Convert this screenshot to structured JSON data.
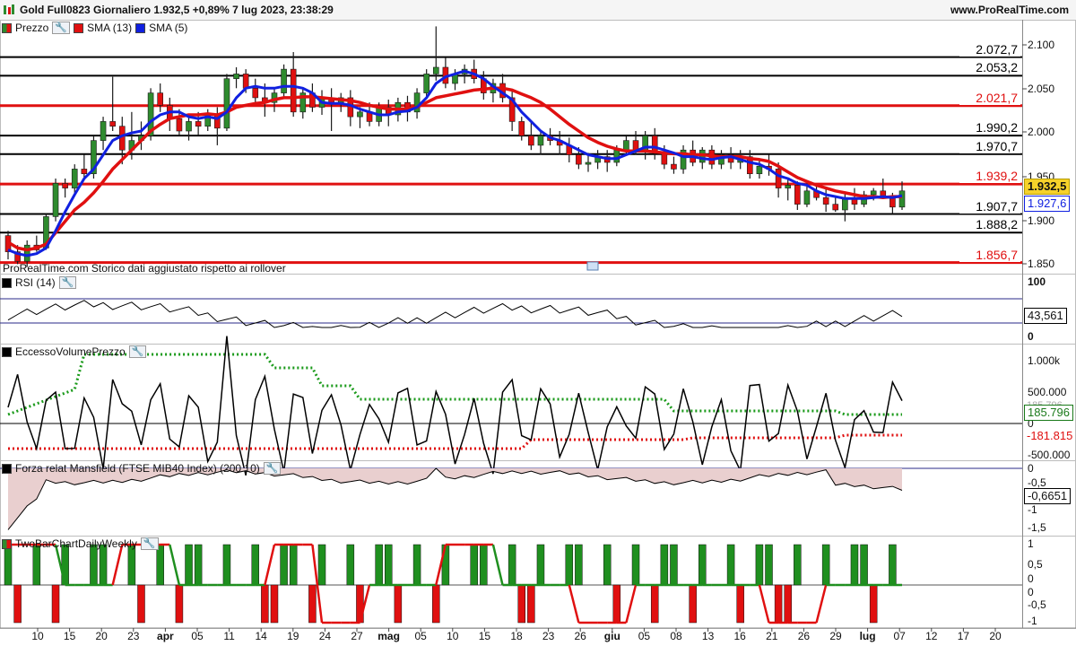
{
  "header": {
    "title": "Gold Full0823 Giornaliero 1.932,5 +0,89% 7 lug 2023, 23:38:29",
    "brand": "www.ProRealTime.com"
  },
  "price_panel": {
    "legend": [
      {
        "label": "Prezzo",
        "color": "#2e8b2e"
      },
      {
        "label": "SMA (13)",
        "color": "#e01010"
      },
      {
        "label": "SMA (5)",
        "color": "#1020e0"
      }
    ],
    "footnote": "ProRealTime.com  Storico dati aggiustato rispetto ai rollover",
    "y_ticks": [
      "2.100",
      "2.050",
      "2.000",
      "1.950",
      "1.900",
      "1.850"
    ],
    "levels": [
      {
        "label": "2.072,7",
        "value": 2072.7,
        "color": "#000000"
      },
      {
        "label": "2.053,2",
        "value": 2053.2,
        "color": "#000000"
      },
      {
        "label": "2.021,7",
        "value": 2021.7,
        "color": "#e01010"
      },
      {
        "label": "1.990,2",
        "value": 1990.2,
        "color": "#000000"
      },
      {
        "label": "1.970,7",
        "value": 1970.7,
        "color": "#000000"
      },
      {
        "label": "1.939,2",
        "value": 1939.2,
        "color": "#e01010"
      },
      {
        "label": "1.907,7",
        "value": 1907.7,
        "color": "#000000"
      },
      {
        "label": "1.888,2",
        "value": 1888.2,
        "color": "#000000"
      },
      {
        "label": "1.856,7",
        "value": 1856.7,
        "color": "#e01010"
      }
    ],
    "last_price": "1.932,5",
    "sma5_last": "1.927,6"
  },
  "rsi_panel": {
    "title": "RSI (14)",
    "ticks": [
      "100",
      "0"
    ],
    "value": "43,561"
  },
  "volume_panel": {
    "title": "EccessoVolumePrezzo",
    "ticks": [
      "1.000k",
      "500.000",
      "0",
      "-500.000"
    ],
    "upper_label": "185.796",
    "upper_hidden": "185.796",
    "lower_label": "-181.815"
  },
  "mansfield_panel": {
    "title": "Forza relat Mansfield (FTSE MIB40 Index) (200 10)",
    "ticks": [
      "0",
      "-0,5",
      "-1",
      "-1,5"
    ],
    "value": "-0,6651"
  },
  "twobar_panel": {
    "title": "TwoBarChartDailyWeekly",
    "ticks": [
      "1",
      "0,5",
      "0",
      "0",
      "-0,5",
      "-1"
    ]
  },
  "x_axis": [
    "10",
    "15",
    "20",
    "23",
    "apr",
    "05",
    "11",
    "14",
    "19",
    "24",
    "27",
    "mag",
    "05",
    "10",
    "15",
    "18",
    "23",
    "26",
    "giu",
    "05",
    "08",
    "13",
    "16",
    "21",
    "26",
    "29",
    "lug",
    "07",
    "12",
    "17",
    "20"
  ],
  "x_axis_bold": [
    "apr",
    "mag",
    "giu",
    "lug"
  ],
  "chart_data": {
    "type": "candlestick",
    "title": "Gold Full0823 Giornaliero",
    "ylim": [
      1845,
      2112
    ],
    "ohlc": [
      [
        1885,
        1890,
        1860,
        1868
      ],
      [
        1868,
        1875,
        1855,
        1858
      ],
      [
        1858,
        1880,
        1852,
        1875
      ],
      [
        1875,
        1885,
        1868,
        1870
      ],
      [
        1872,
        1908,
        1870,
        1905
      ],
      [
        1905,
        1945,
        1900,
        1940
      ],
      [
        1940,
        1945,
        1925,
        1935
      ],
      [
        1935,
        1960,
        1930,
        1955
      ],
      [
        1955,
        1970,
        1945,
        1950
      ],
      [
        1950,
        1990,
        1945,
        1985
      ],
      [
        1985,
        2010,
        1975,
        2005
      ],
      [
        2005,
        2052,
        1995,
        2000
      ],
      [
        2000,
        2010,
        1960,
        1975
      ],
      [
        1975,
        2015,
        1965,
        1985
      ],
      [
        1985,
        2005,
        1975,
        1990
      ],
      [
        1990,
        2040,
        1985,
        2035
      ],
      [
        2035,
        2045,
        2015,
        2022
      ],
      [
        2022,
        2030,
        1995,
        2008
      ],
      [
        2008,
        2018,
        1990,
        1995
      ],
      [
        1995,
        2010,
        1985,
        2005
      ],
      [
        2005,
        2015,
        1990,
        2000
      ],
      [
        2000,
        2018,
        1995,
        2012
      ],
      [
        2012,
        2020,
        1980,
        1998
      ],
      [
        1998,
        2055,
        1995,
        2050
      ],
      [
        2050,
        2062,
        2040,
        2055
      ],
      [
        2055,
        2060,
        2035,
        2040
      ],
      [
        2040,
        2050,
        2025,
        2030
      ],
      [
        2030,
        2045,
        2010,
        2025
      ],
      [
        2025,
        2040,
        2015,
        2035
      ],
      [
        2035,
        2065,
        2030,
        2060
      ],
      [
        2060,
        2078,
        2010,
        2015
      ],
      [
        2015,
        2040,
        2008,
        2035
      ],
      [
        2035,
        2045,
        2015,
        2020
      ],
      [
        2020,
        2038,
        2012,
        2030
      ],
      [
        2030,
        2040,
        1995,
        2025
      ],
      [
        2025,
        2035,
        2015,
        2030
      ],
      [
        2030,
        2038,
        2000,
        2010
      ],
      [
        2010,
        2020,
        1998,
        2015
      ],
      [
        2015,
        2025,
        2000,
        2005
      ],
      [
        2005,
        2025,
        2000,
        2020
      ],
      [
        2020,
        2028,
        2000,
        2012
      ],
      [
        2012,
        2030,
        2005,
        2025
      ],
      [
        2025,
        2032,
        2005,
        2015
      ],
      [
        2015,
        2040,
        2008,
        2035
      ],
      [
        2035,
        2060,
        2030,
        2055
      ],
      [
        2055,
        2105,
        2048,
        2062
      ],
      [
        2062,
        2072,
        2040,
        2045
      ],
      [
        2045,
        2060,
        2038,
        2055
      ],
      [
        2055,
        2065,
        2045,
        2060
      ],
      [
        2060,
        2070,
        2045,
        2050
      ],
      [
        2050,
        2058,
        2028,
        2035
      ],
      [
        2035,
        2050,
        2025,
        2045
      ],
      [
        2045,
        2055,
        2025,
        2030
      ],
      [
        2030,
        2038,
        1995,
        2005
      ],
      [
        2005,
        2010,
        1985,
        1990
      ],
      [
        1990,
        2005,
        1975,
        1980
      ],
      [
        1980,
        1995,
        1970,
        1990
      ],
      [
        1990,
        1998,
        1980,
        1985
      ],
      [
        1985,
        1995,
        1970,
        1980
      ],
      [
        1980,
        1988,
        1962,
        1970
      ],
      [
        1970,
        1978,
        1955,
        1960
      ],
      [
        1960,
        1972,
        1952,
        1962
      ],
      [
        1962,
        1975,
        1955,
        1968
      ],
      [
        1968,
        1975,
        1952,
        1962
      ],
      [
        1962,
        1980,
        1958,
        1975
      ],
      [
        1975,
        1990,
        1970,
        1985
      ],
      [
        1985,
        1995,
        1970,
        1975
      ],
      [
        1975,
        1995,
        1965,
        1990
      ],
      [
        1990,
        1998,
        1965,
        1972
      ],
      [
        1972,
        1980,
        1955,
        1960
      ],
      [
        1960,
        1968,
        1950,
        1955
      ],
      [
        1955,
        1980,
        1950,
        1975
      ],
      [
        1975,
        1985,
        1958,
        1962
      ],
      [
        1962,
        1978,
        1955,
        1975
      ],
      [
        1975,
        1980,
        1955,
        1960
      ],
      [
        1960,
        1975,
        1955,
        1970
      ],
      [
        1970,
        1978,
        1955,
        1962
      ],
      [
        1962,
        1975,
        1955,
        1968
      ],
      [
        1968,
        1975,
        1945,
        1950
      ],
      [
        1950,
        1965,
        1945,
        1958
      ],
      [
        1958,
        1970,
        1948,
        1955
      ],
      [
        1955,
        1962,
        1925,
        1935
      ],
      [
        1935,
        1945,
        1922,
        1938
      ],
      [
        1938,
        1942,
        1912,
        1918
      ],
      [
        1918,
        1940,
        1915,
        1932
      ],
      [
        1932,
        1938,
        1922,
        1925
      ],
      [
        1925,
        1935,
        1910,
        1918
      ],
      [
        1918,
        1925,
        1910,
        1912
      ],
      [
        1912,
        1930,
        1900,
        1925
      ],
      [
        1925,
        1935,
        1912,
        1918
      ],
      [
        1918,
        1932,
        1915,
        1928
      ],
      [
        1928,
        1935,
        1922,
        1932
      ],
      [
        1932,
        1945,
        1925,
        1926
      ],
      [
        1926,
        1930,
        1908,
        1915
      ],
      [
        1915,
        1942,
        1912,
        1932
      ]
    ],
    "sma13": [
      1878,
      1872,
      1870,
      1872,
      1876,
      1888,
      1900,
      1912,
      1920,
      1930,
      1942,
      1955,
      1965,
      1975,
      1985,
      1995,
      2002,
      2008,
      2010,
      2012,
      2012,
      2013,
      2012,
      2015,
      2020,
      2022,
      2024,
      2025,
      2028,
      2030,
      2030,
      2031,
      2031,
      2030,
      2029,
      2028,
      2027,
      2025,
      2022,
      2020,
      2018,
      2018,
      2018,
      2020,
      2025,
      2030,
      2032,
      2034,
      2036,
      2038,
      2039,
      2040,
      2040,
      2038,
      2034,
      2030,
      2025,
      2018,
      2010,
      2002,
      1995,
      1988,
      1983,
      1979,
      1976,
      1974,
      1974,
      1974,
      1973,
      1972,
      1971,
      1971,
      1970,
      1970,
      1969,
      1968,
      1968,
      1968,
      1966,
      1965,
      1963,
      1958,
      1952,
      1946,
      1942,
      1938,
      1935,
      1932,
      1930,
      1928,
      1926,
      1926,
      1925,
      1926,
      1926
    ],
    "sma5": [
      1870,
      1866,
      1864,
      1866,
      1872,
      1890,
      1910,
      1928,
      1945,
      1955,
      1970,
      1985,
      1990,
      1993,
      1995,
      2005,
      2012,
      2015,
      2015,
      2010,
      2008,
      2010,
      2008,
      2015,
      2030,
      2040,
      2042,
      2040,
      2040,
      2042,
      2042,
      2040,
      2035,
      2025,
      2024,
      2024,
      2022,
      2018,
      2015,
      2012,
      2012,
      2015,
      2016,
      2020,
      2030,
      2045,
      2052,
      2055,
      2058,
      2055,
      2050,
      2042,
      2035,
      2028,
      2015,
      2005,
      1995,
      1988,
      1985,
      1980,
      1975,
      1970,
      1968,
      1966,
      1966,
      1970,
      1974,
      1978,
      1978,
      1975,
      1972,
      1968,
      1968,
      1966,
      1965,
      1967,
      1968,
      1965,
      1962,
      1960,
      1955,
      1948,
      1945,
      1940,
      1938,
      1932,
      1928,
      1926,
      1924,
      1924,
      1924,
      1925,
      1926,
      1925,
      1927
    ]
  }
}
